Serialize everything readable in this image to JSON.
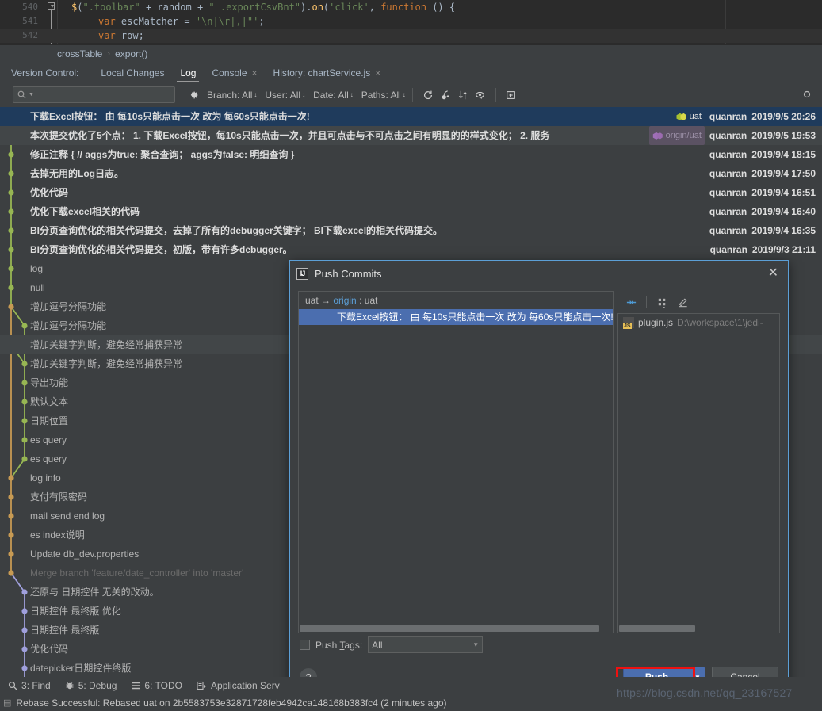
{
  "editor": {
    "lines": [
      {
        "num": "540",
        "segments": [
          {
            "t": "$",
            "c": "dollar"
          },
          {
            "t": "(",
            "c": "plain"
          },
          {
            "t": "\".toolbar\"",
            "c": "str"
          },
          {
            "t": " + random + ",
            "c": "plain"
          },
          {
            "t": "\" .exportCsvBnt\"",
            "c": "str"
          },
          {
            "t": ").",
            "c": "plain"
          },
          {
            "t": "on",
            "c": "fn"
          },
          {
            "t": "(",
            "c": "plain"
          },
          {
            "t": "'click'",
            "c": "str"
          },
          {
            "t": ", ",
            "c": "plain"
          },
          {
            "t": "function",
            "c": "def"
          },
          {
            "t": " () {",
            "c": "plain"
          }
        ],
        "indent": 90
      },
      {
        "num": "541",
        "segments": [
          {
            "t": "var",
            "c": "def"
          },
          {
            "t": " escMatcher = ",
            "c": "plain"
          },
          {
            "t": "'\\n|\\r|,|\"'",
            "c": "str"
          },
          {
            "t": ";",
            "c": "plain"
          }
        ],
        "indent": 124
      },
      {
        "num": "542",
        "segments": [
          {
            "t": "var",
            "c": "def"
          },
          {
            "t": " row;",
            "c": "plain"
          }
        ],
        "indent": 124
      }
    ]
  },
  "breadcrumb": {
    "items": [
      "crossTable",
      "export()"
    ],
    "separator": "›"
  },
  "tool_window": {
    "label": "Version Control:",
    "tabs": [
      {
        "label": "Local Changes",
        "active": false,
        "closable": false
      },
      {
        "label": "Log",
        "active": true,
        "closable": false
      },
      {
        "label": "Console",
        "active": false,
        "closable": true
      },
      {
        "label": "History: chartService.js",
        "active": false,
        "closable": true
      }
    ],
    "close_glyph": "×"
  },
  "filters": {
    "search_placeholder": "",
    "search_value": "",
    "search_icon": "search-icon",
    "gear_icon": "gear-icon",
    "items": [
      {
        "label": "Branch: All"
      },
      {
        "label": "User: All"
      },
      {
        "label": "Date: All"
      },
      {
        "label": "Paths: All"
      }
    ],
    "carat": "↕",
    "tool_icons": [
      "refresh-icon",
      "cherry-pick-icon",
      "sort-icon",
      "eye-icon",
      "new-window-icon"
    ]
  },
  "log": {
    "rows": [
      {
        "subject": "下载Excel按钮：  由 每10s只能点击一次 改为 每60s只能点击一次!",
        "author": "quanran",
        "date": "2019/9/5 20:26",
        "selected": true,
        "alt": false,
        "tone": "bold",
        "ref": {
          "text": "uat",
          "kind": "local"
        },
        "dot": "green"
      },
      {
        "subject": "本次提交优化了5个点：  1. 下载Excel按钮，每10s只能点击一次，并且可点击与不可点击之间有明显的的样式变化；  2. 服务",
        "author": "quanran",
        "date": "2019/9/5 19:53",
        "selected": false,
        "alt": true,
        "tone": "bold",
        "ref": {
          "text": "origin/uat",
          "kind": "remote"
        },
        "dot": "green"
      },
      {
        "subject": "修正注释 {     // aggs为true: 聚合查询； aggs为false: 明细查询 }",
        "author": "quanran",
        "date": "2019/9/4 18:15",
        "selected": false,
        "alt": false,
        "tone": "bold",
        "ref": null,
        "dot": "green"
      },
      {
        "subject": "去掉无用的Log日志。",
        "author": "quanran",
        "date": "2019/9/4 17:50",
        "selected": false,
        "alt": false,
        "tone": "bold",
        "ref": null,
        "dot": "green"
      },
      {
        "subject": "优化代码",
        "author": "quanran",
        "date": "2019/9/4 16:51",
        "selected": false,
        "alt": false,
        "tone": "bold",
        "ref": null,
        "dot": "green"
      },
      {
        "subject": "优化下载excel相关的代码",
        "author": "quanran",
        "date": "2019/9/4 16:40",
        "selected": false,
        "alt": false,
        "tone": "bold",
        "ref": null,
        "dot": "green"
      },
      {
        "subject": "BI分页查询优化的相关代码提交，去掉了所有的debugger关键字；  BI下载excel的相关代码提交。",
        "author": "quanran",
        "date": "2019/9/4 16:35",
        "selected": false,
        "alt": false,
        "tone": "bold",
        "ref": null,
        "dot": "green"
      },
      {
        "subject": "BI分页查询优化的相关代码提交，初版，带有许多debugger。",
        "author": "quanran",
        "date": "2019/9/3 21:11",
        "selected": false,
        "alt": false,
        "tone": "bold",
        "ref": null,
        "dot": "green"
      },
      {
        "subject": "log",
        "author": "",
        "date": "",
        "selected": false,
        "alt": false,
        "tone": "light",
        "ref": null,
        "dot": "green"
      },
      {
        "subject": "null",
        "author": "",
        "date": "",
        "selected": false,
        "alt": false,
        "tone": "light",
        "ref": null,
        "dot": "green"
      },
      {
        "subject": "增加逗号分隔功能",
        "author": "",
        "date": "",
        "selected": false,
        "alt": false,
        "tone": "light",
        "ref": null,
        "dot": "tan"
      },
      {
        "subject": "增加逗号分隔功能",
        "author": "",
        "date": "",
        "selected": false,
        "alt": false,
        "tone": "light",
        "ref": null,
        "dot": "green"
      },
      {
        "subject": "增加关键字判断，避免经常捕获异常",
        "author": "",
        "date": "",
        "selected": false,
        "alt": true,
        "tone": "light",
        "ref": null,
        "dot": "tan"
      },
      {
        "subject": "增加关键字判断，避免经常捕获异常",
        "author": "",
        "date": "",
        "selected": false,
        "alt": false,
        "tone": "light",
        "ref": null,
        "dot": "green"
      },
      {
        "subject": "导出功能",
        "author": "",
        "date": "",
        "selected": false,
        "alt": false,
        "tone": "light",
        "ref": null,
        "dot": "green"
      },
      {
        "subject": "默认文本",
        "author": "",
        "date": "",
        "selected": false,
        "alt": false,
        "tone": "light",
        "ref": null,
        "dot": "green"
      },
      {
        "subject": "日期位置",
        "author": "",
        "date": "",
        "selected": false,
        "alt": false,
        "tone": "light",
        "ref": null,
        "dot": "green"
      },
      {
        "subject": "es query",
        "author": "",
        "date": "",
        "selected": false,
        "alt": false,
        "tone": "light",
        "ref": null,
        "dot": "green"
      },
      {
        "subject": "es query",
        "author": "",
        "date": "",
        "selected": false,
        "alt": false,
        "tone": "light",
        "ref": null,
        "dot": "green"
      },
      {
        "subject": "log info",
        "author": "",
        "date": "",
        "selected": false,
        "alt": false,
        "tone": "light",
        "ref": null,
        "dot": "tan"
      },
      {
        "subject": "支付有限密码",
        "author": "",
        "date": "",
        "selected": false,
        "alt": false,
        "tone": "light",
        "ref": null,
        "dot": "tan"
      },
      {
        "subject": "mail send end log",
        "author": "",
        "date": "",
        "selected": false,
        "alt": false,
        "tone": "light",
        "ref": null,
        "dot": "tan"
      },
      {
        "subject": "es index说明",
        "author": "",
        "date": "",
        "selected": false,
        "alt": false,
        "tone": "light",
        "ref": null,
        "dot": "tan"
      },
      {
        "subject": "Update db_dev.properties",
        "author": "",
        "date": "",
        "selected": false,
        "alt": false,
        "tone": "light",
        "ref": null,
        "dot": "tan"
      },
      {
        "subject": "Merge branch 'feature/date_controller' into 'master'",
        "author": "",
        "date": "",
        "selected": false,
        "alt": false,
        "tone": "dim",
        "ref": null,
        "dot": "tan"
      },
      {
        "subject": "还原与 日期控件 无关的改动。",
        "author": "",
        "date": "",
        "selected": false,
        "alt": false,
        "tone": "light",
        "ref": null,
        "dot": "lav"
      },
      {
        "subject": "日期控件 最终版 优化",
        "author": "",
        "date": "",
        "selected": false,
        "alt": false,
        "tone": "light",
        "ref": null,
        "dot": "lav"
      },
      {
        "subject": "日期控件 最终版",
        "author": "",
        "date": "",
        "selected": false,
        "alt": false,
        "tone": "light",
        "ref": null,
        "dot": "lav"
      },
      {
        "subject": "优化代码",
        "author": "",
        "date": "",
        "selected": false,
        "alt": false,
        "tone": "light",
        "ref": null,
        "dot": "lav"
      },
      {
        "subject": "datepicker日期控件终版",
        "author": "",
        "date": "",
        "selected": false,
        "alt": false,
        "tone": "light",
        "ref": null,
        "dot": "lav"
      }
    ]
  },
  "dialog": {
    "title": "Push Commits",
    "logo": "IJ",
    "close_glyph": "✕",
    "tree": {
      "root_source": "uat",
      "arrow": "→",
      "root_remote": "origin",
      "root_colon": ":",
      "root_target": "uat",
      "commit": "下载Excel按钮：  由 每10s只能点击一次 改为 每60s只能点击一次!"
    },
    "right_toolbar_icons": [
      "expand-collapse-icon",
      "group-by-icon",
      "edit-icon"
    ],
    "files": [
      {
        "name": "plugin.js",
        "path": "D:\\workspace\\1\\jedi-",
        "icon": "js-file-icon"
      }
    ],
    "push_tags": {
      "label": "Push ",
      "label_underline": "T",
      "label_rest": "ags:",
      "value": "All",
      "checked": false
    },
    "help_glyph": "?",
    "buttons": {
      "push": {
        "pre": "P",
        "underline": "u",
        "post": "sh"
      },
      "push_dropdown": "▼",
      "cancel": "Cancel"
    }
  },
  "bottom_tools": [
    {
      "num": "3",
      "label": ": Find",
      "icon": "search-icon"
    },
    {
      "num": "5",
      "label": ": Debug",
      "icon": "bug-icon"
    },
    {
      "num": "6",
      "label": ": TODO",
      "icon": "list-icon"
    },
    {
      "num": "",
      "label": "Application Serv",
      "icon": "server-icon"
    }
  ],
  "status": {
    "text": "Rebase Successful: Rebased uat on 2b5583753e32871728feb4942ca148168b383fc4 (2 minutes ago)",
    "icon": "info-icon"
  },
  "watermark": "https://blog.csdn.net/qq_23167527",
  "colors": {
    "accent": "#4b6eaf",
    "selection": "#1f3b5c",
    "graph_green": "#97b653",
    "graph_tan": "#c79a53",
    "graph_lavender": "#a0a0dd",
    "highlight_box": "#ee1111",
    "background": "#3c3f41",
    "editor_bg": "#2b2b2b"
  }
}
